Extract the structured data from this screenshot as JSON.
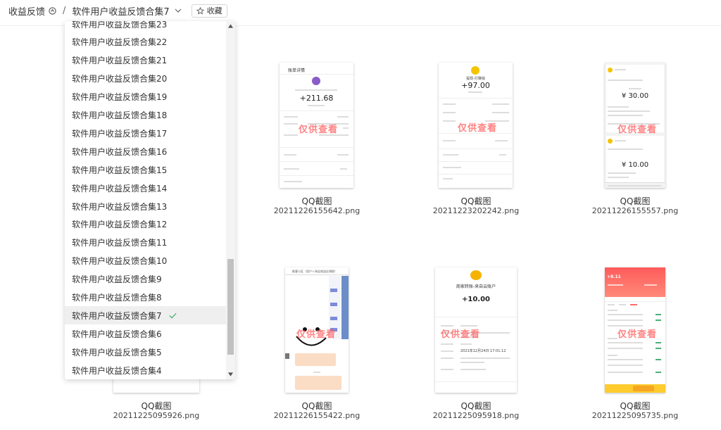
{
  "header": {
    "root": "收益反馈",
    "separator": "/",
    "current": "软件用户收益反馈合集7",
    "favorite": "收藏"
  },
  "dropdown": {
    "items": [
      "软件用户收益反馈合集23",
      "软件用户收益反馈合集22",
      "软件用户收益反馈合集21",
      "软件用户收益反馈合集20",
      "软件用户收益反馈合集19",
      "软件用户收益反馈合集18",
      "软件用户收益反馈合集17",
      "软件用户收益反馈合集16",
      "软件用户收益反馈合集15",
      "软件用户收益反馈合集14",
      "软件用户收益反馈合集13",
      "软件用户收益反馈合集12",
      "软件用户收益反馈合集11",
      "软件用户收益反馈合集10",
      "软件用户收益反馈合集9",
      "软件用户收益反馈合集8",
      "软件用户收益反馈合集7",
      "软件用户收益反馈合集6",
      "软件用户收益反馈合集5",
      "软件用户收益反馈合集4"
    ],
    "selected_index": 16
  },
  "files": [
    {
      "name": "QQ截图",
      "file": "20211226155642.png",
      "amount": "+211.68",
      "title": "账单详情",
      "watermark": "仅供查看"
    },
    {
      "name": "QQ截图",
      "file": "20211223202242.png",
      "amount": "+97.00",
      "title": "提现-打赚钱",
      "watermark": "仅供查看"
    },
    {
      "name": "QQ截图",
      "file": "20211226155557.png",
      "amount1": "¥ 30.00",
      "amount2": "¥ 10.00",
      "watermark": "仅供查看"
    },
    {
      "name": "QQ截图",
      "file": "20211225095926.png"
    },
    {
      "name": "QQ截图",
      "file": "20211226155422.png",
      "title": "推客小区（用户＋淘宝收益反馈群）",
      "watermark": "仅供查看"
    },
    {
      "name": "QQ截图",
      "file": "20211225095918.png",
      "title": "商家转账-来自云账户",
      "amount": "+10.00",
      "date": "2021年12月24日 17:01:12",
      "watermark": "仅供查看"
    },
    {
      "name": "QQ截图",
      "file": "20211225095735.png",
      "amount": "+8.11",
      "watermark": "仅供查看"
    }
  ],
  "colors": {
    "accent_red": "#ff4e4e",
    "check_green": "#4caf7a"
  }
}
